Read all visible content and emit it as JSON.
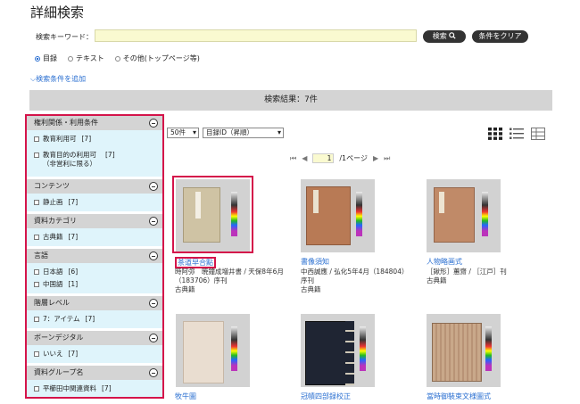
{
  "header": {
    "title": "詳細検索"
  },
  "search": {
    "label": "検索キーワード：",
    "value": "",
    "search_button": "検索",
    "clear_button": "条件をクリア"
  },
  "scope": [
    {
      "label": "目録",
      "selected": true
    },
    {
      "label": "テキスト",
      "selected": false
    },
    {
      "label": "その他(トップページ等)",
      "selected": false
    }
  ],
  "add_condition": "検索条件を追加",
  "result_summary": "検索結果：7件",
  "facets": [
    {
      "title": "権利関係・利用条件",
      "items": [
        {
          "label": "教育利用可",
          "count": "[7]"
        },
        {
          "label": "教育目的の利用可\n（非営利に限る）",
          "count": "[7]"
        }
      ]
    },
    {
      "title": "コンテンツ",
      "items": [
        {
          "label": "静止画",
          "count": "[7]"
        }
      ]
    },
    {
      "title": "資料カテゴリ",
      "items": [
        {
          "label": "古典籍",
          "count": "[7]"
        }
      ]
    },
    {
      "title": "言語",
      "items": [
        {
          "label": "日本語",
          "count": "[6]"
        },
        {
          "label": "中国語",
          "count": "[1]"
        }
      ]
    },
    {
      "title": "階層レベル",
      "items": [
        {
          "label": "7：アイテム",
          "count": "[7]"
        }
      ]
    },
    {
      "title": "ボーンデジタル",
      "items": [
        {
          "label": "いいえ",
          "count": "[7]"
        }
      ]
    },
    {
      "title": "資料グループ名",
      "items": [
        {
          "label": "平櫛田中関連資料",
          "count": "[7]"
        }
      ]
    }
  ],
  "toolbar": {
    "per_page": "50件",
    "sort": "目録ID（昇順）"
  },
  "pager": {
    "current": "1",
    "total": "/1ページ"
  },
  "results": [
    {
      "title": "茶道早合點",
      "meta": [
        "時阿弥　暁鐘成増井書 / 天保8年6月",
        "（183706）序刊",
        "古典籍"
      ]
    },
    {
      "title": "書像須知",
      "meta": [
        "中西誠應 / 弘化5年4月（184804）",
        "序刊",
        "古典籍"
      ]
    },
    {
      "title": "人物略画式",
      "meta": [
        "［鍬形］蕙齋 / ［江戸］刊",
        "古典籍"
      ]
    },
    {
      "title": "牧牛圖",
      "meta": []
    },
    {
      "title": "冠幘四部録校正",
      "meta": []
    },
    {
      "title": "當時御裝束文様圖式",
      "meta": []
    }
  ],
  "colors": {
    "accent": "#2a6fd1",
    "highlight": "#d4144a",
    "facet_bg": "#dff4fb",
    "header_bg": "#d4d4d4"
  }
}
